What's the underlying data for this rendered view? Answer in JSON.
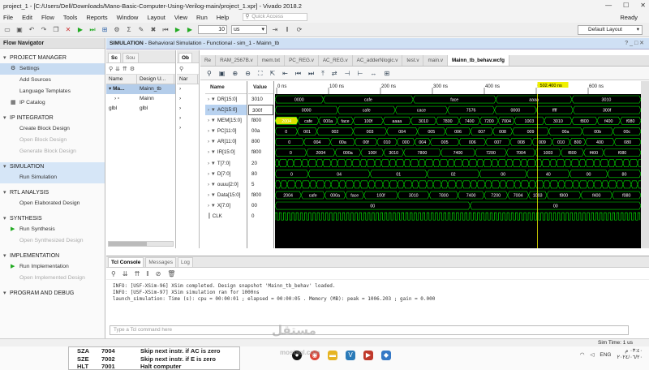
{
  "window": {
    "title": "project_1 - [C:/Users/Dell/Downloads/Mano-Basic-Computer-Using-Verilog-main/project_1.xpr] - Vivado 2018.2",
    "status": "Ready"
  },
  "menu": [
    "File",
    "Edit",
    "Flow",
    "Tools",
    "Reports",
    "Window",
    "Layout",
    "View",
    "Run",
    "Help"
  ],
  "quick_access_placeholder": "Quick Access",
  "toolbar": {
    "time_value": "10",
    "time_unit": "us",
    "layout": "Default Layout"
  },
  "flow_navigator": {
    "title": "Flow Navigator",
    "sections": [
      {
        "name": "PROJECT MANAGER",
        "items": [
          {
            "label": "Settings",
            "icon": "gear-icon",
            "enabled": true
          },
          {
            "label": "Add Sources",
            "enabled": true
          },
          {
            "label": "Language Templates",
            "enabled": true
          },
          {
            "label": "IP Catalog",
            "icon": "ip-icon",
            "enabled": true
          }
        ]
      },
      {
        "name": "IP INTEGRATOR",
        "items": [
          {
            "label": "Create Block Design",
            "enabled": true
          },
          {
            "label": "Open Block Design",
            "enabled": false
          },
          {
            "label": "Generate Block Design",
            "enabled": false
          }
        ]
      },
      {
        "name": "SIMULATION",
        "items": [
          {
            "label": "Run Simulation",
            "enabled": true
          }
        ]
      },
      {
        "name": "RTL ANALYSIS",
        "items": [
          {
            "label": "Open Elaborated Design",
            "enabled": true
          }
        ]
      },
      {
        "name": "SYNTHESIS",
        "items": [
          {
            "label": "Run Synthesis",
            "icon": "play-icon",
            "enabled": true
          },
          {
            "label": "Open Synthesized Design",
            "enabled": false
          }
        ]
      },
      {
        "name": "IMPLEMENTATION",
        "items": [
          {
            "label": "Run Implementation",
            "icon": "play-icon",
            "enabled": true
          },
          {
            "label": "Open Implemented Design",
            "enabled": false
          }
        ]
      },
      {
        "name": "PROGRAM AND DEBUG",
        "items": []
      }
    ]
  },
  "sim_header": {
    "bold": "SIMULATION",
    "rest": " - Behavioral Simulation - Functional - sim_1 - Mainn_tb"
  },
  "scope": {
    "tabs": [
      "Sc",
      "Sou"
    ],
    "columns": [
      "Name",
      "Design U..."
    ],
    "rows": [
      {
        "name": "Ma...",
        "unit": "Mainn_tb",
        "selected": true
      },
      {
        "name": "",
        "unit": "Mainn",
        "selected": false
      },
      {
        "name": "glbl",
        "unit": "glbl",
        "selected": false
      }
    ]
  },
  "objects": {
    "tabs": [
      "Ob"
    ],
    "column": "Nar"
  },
  "file_tabs": [
    "Re",
    "RAM_2567B.v",
    "mem.txt",
    "PC_REG.v",
    "AC_REG.v",
    "AC_adderNlogic.v",
    "test.v",
    "main.v",
    "Mainn_tb_behav.wcfg"
  ],
  "wave": {
    "name_header": "Name",
    "value_header": "Value",
    "cursor_label": "502.400 ns",
    "time_ticks": [
      "0 ns",
      "100 ns",
      "200 ns",
      "300 ns",
      "400 ns",
      "500 ns",
      "600 ns"
    ],
    "signals": [
      {
        "name": "DR[15:0]",
        "value": "3010",
        "icon": "bus",
        "segments": [
          "0000",
          "cafe",
          "face",
          "aaaa",
          "3010"
        ]
      },
      {
        "name": "AC[15:0]",
        "value": "300f",
        "icon": "bus",
        "selected": true,
        "segments": [
          "0000",
          "cafe",
          "cace",
          "7576",
          "0000",
          "ffff",
          "300f"
        ]
      },
      {
        "name": "MEM[15:0]",
        "value": "f800",
        "icon": "bus",
        "segments": [
          "2004",
          "cafe",
          "000a",
          "face",
          "100f",
          "aaaa",
          "3010",
          "7800",
          "7400",
          "7200",
          "7004",
          "1003",
          "3010",
          "f800",
          "f400",
          "f080"
        ]
      },
      {
        "name": "PC[11:0]",
        "value": "00a",
        "icon": "bus",
        "segments": [
          "0",
          "001",
          "002",
          "003",
          "004",
          "005",
          "006",
          "007",
          "008",
          "009",
          "00a",
          "00b",
          "00c"
        ]
      },
      {
        "name": "AR[11:0]",
        "value": "800",
        "icon": "bus",
        "segments": [
          "0",
          "004",
          "00a",
          "00f",
          "010",
          "000",
          "004",
          "005",
          "006",
          "007",
          "008",
          "009",
          "010",
          "800",
          "400",
          "080"
        ]
      },
      {
        "name": "IR[15:0]",
        "value": "f800",
        "icon": "bus",
        "segments": [
          "0",
          "2004",
          "000a",
          "100f",
          "3010",
          "7800",
          "7400",
          "7200",
          "7004",
          "1003",
          "f800",
          "f400",
          "f080"
        ]
      },
      {
        "name": "T[7:0]",
        "value": "20",
        "icon": "bus",
        "segments": []
      },
      {
        "name": "D[7:0]",
        "value": "80",
        "icon": "bus",
        "segments": [
          "0",
          "04",
          "01",
          "02",
          "00",
          "40",
          "00",
          "80"
        ]
      },
      {
        "name": "ouuu[2:0]",
        "value": "5",
        "icon": "bus",
        "segments": []
      },
      {
        "name": "Data[15:0]",
        "value": "f800",
        "icon": "bus",
        "segments": [
          "2004",
          "cafe",
          "000a",
          "face",
          "100f",
          "3010",
          "7800",
          "7400",
          "7200",
          "7004",
          "1003",
          "f800",
          "f400",
          "f080"
        ]
      },
      {
        "name": "X[7:0]",
        "value": "00",
        "icon": "bus",
        "segments": [
          "00",
          "00"
        ]
      },
      {
        "name": "CLK",
        "value": "0",
        "icon": "bit",
        "segments": []
      }
    ]
  },
  "console": {
    "tabs": [
      "Tcl Console",
      "Messages",
      "Log"
    ],
    "lines": [
      "INFO: [USF-XSim-96] XSim completed. Design snapshot 'Mainn_tb_behav' loaded.",
      "INFO: [USF-XSim-97] XSim simulation ran for 1000ns",
      "launch_simulation: Time (s): cpu = 00:00:01 ; elapsed = 00:00:05 . Memory (MB): peak = 1006.203 ; gain = 0.000"
    ],
    "input_placeholder": "Type a Tcl command here"
  },
  "status_bar": "Sim Time: 1 us",
  "overlay_table": [
    [
      "SZA",
      "7004",
      "Skip next instr. if AC is zero"
    ],
    [
      "SZE",
      "7002",
      "Skip next instr. if E is zero"
    ],
    [
      "HLT",
      "7001",
      "Halt computer"
    ]
  ],
  "taskbar": {
    "lang": "ENG",
    "time": "٠٣:٤٠ م",
    "date": "٢٠٢٤/٠٦/٢٠"
  },
  "watermark": {
    "arabic": "مستقل",
    "latin": "mostaql.com"
  },
  "colors": {
    "wave_bus": "#00e000",
    "cursor": "#f0f000",
    "selection": "#b8d2f0",
    "sim_header": "#cfe0f4"
  }
}
